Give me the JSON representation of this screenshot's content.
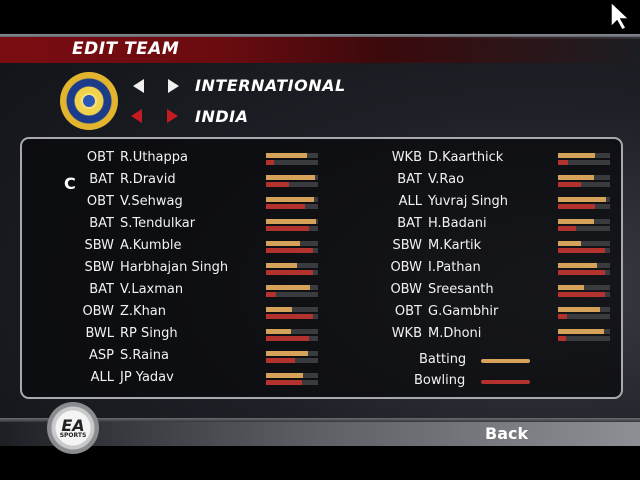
{
  "header": {
    "title": "EDIT TEAM"
  },
  "selectors": {
    "category": "INTERNATIONAL",
    "team": "INDIA"
  },
  "captain_marker": "C",
  "left_players": [
    {
      "role": "OBT",
      "name": "R.Uthappa",
      "batting": 0.78,
      "bowling": 0.15
    },
    {
      "role": "BAT",
      "name": "R.Dravid",
      "batting": 0.95,
      "bowling": 0.45
    },
    {
      "role": "OBT",
      "name": "V.Sehwag",
      "batting": 0.92,
      "bowling": 0.75
    },
    {
      "role": "BAT",
      "name": "S.Tendulkar",
      "batting": 0.96,
      "bowling": 0.82
    },
    {
      "role": "SBW",
      "name": "A.Kumble",
      "batting": 0.65,
      "bowling": 0.9
    },
    {
      "role": "SBW",
      "name": "Harbhajan Singh",
      "batting": 0.6,
      "bowling": 0.9
    },
    {
      "role": "BAT",
      "name": "V.Laxman",
      "batting": 0.85,
      "bowling": 0.2
    },
    {
      "role": "OBW",
      "name": "Z.Khan",
      "batting": 0.5,
      "bowling": 0.9
    },
    {
      "role": "BWL",
      "name": "RP Singh",
      "batting": 0.48,
      "bowling": 0.82
    },
    {
      "role": "ASP",
      "name": "S.Raina",
      "batting": 0.8,
      "bowling": 0.55
    },
    {
      "role": "ALL",
      "name": "JP Yadav",
      "batting": 0.72,
      "bowling": 0.7
    }
  ],
  "right_players": [
    {
      "role": "WKB",
      "name": "D.Kaarthick",
      "batting": 0.72,
      "bowling": 0.2
    },
    {
      "role": "BAT",
      "name": "V.Rao",
      "batting": 0.7,
      "bowling": 0.45
    },
    {
      "role": "ALL",
      "name": "Yuvraj Singh",
      "batting": 0.92,
      "bowling": 0.72
    },
    {
      "role": "BAT",
      "name": "H.Badani",
      "batting": 0.7,
      "bowling": 0.35
    },
    {
      "role": "SBW",
      "name": "M.Kartik",
      "batting": 0.45,
      "bowling": 0.9
    },
    {
      "role": "OBW",
      "name": "I.Pathan",
      "batting": 0.75,
      "bowling": 0.9
    },
    {
      "role": "OBW",
      "name": "Sreesanth",
      "batting": 0.5,
      "bowling": 0.9
    },
    {
      "role": "OBT",
      "name": "G.Gambhir",
      "batting": 0.8,
      "bowling": 0.18
    },
    {
      "role": "WKB",
      "name": "M.Dhoni",
      "batting": 0.88,
      "bowling": 0.15
    }
  ],
  "legend": {
    "batting_label": "Batting",
    "bowling_label": "Bowling",
    "batting_color": "#d6a25a",
    "bowling_color": "#b3322e"
  },
  "footer": {
    "back_label": "Back"
  },
  "logos": {
    "ea_text": "EA",
    "ea_sub": "SPORTS",
    "team_badge": "cricket-board-crest-icon"
  },
  "icons": {
    "arrow_left": "triangle-left-icon",
    "arrow_right": "triangle-right-icon",
    "cursor": "mouse-pointer-icon"
  }
}
